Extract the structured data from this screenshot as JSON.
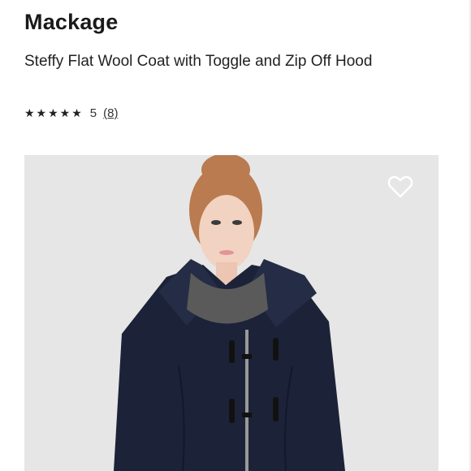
{
  "product": {
    "brand": "Mackage",
    "title": "Steffy Flat Wool Coat with Toggle and Zip Off Hood",
    "rating": {
      "stars": "★★★★★",
      "value": "5",
      "count": "(8)"
    },
    "image": {
      "alt": "Model wearing navy wool coat with toggles and hood",
      "favorite_icon": "heart-outline-icon"
    }
  },
  "colors": {
    "background": "#ffffff",
    "image_background": "#e6e6e6",
    "coat": "#1c2238",
    "scarf": "#5a5a5a"
  }
}
